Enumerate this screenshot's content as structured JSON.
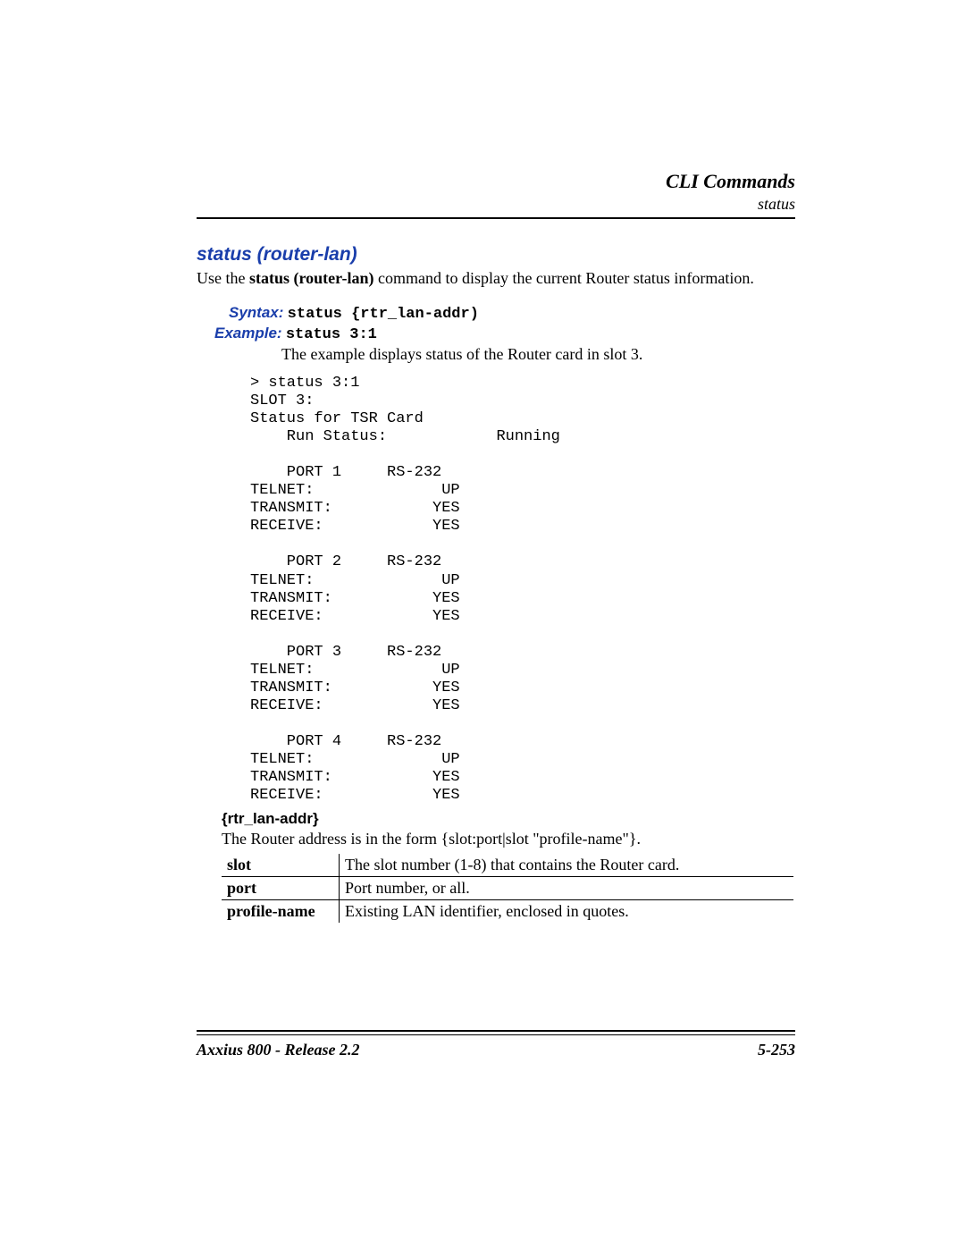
{
  "header": {
    "chapter": "CLI Commands",
    "section": "status"
  },
  "title": "status (router-lan)",
  "intro": {
    "prefix": "Use the ",
    "bold": "status (router-lan)",
    "suffix": " command to display the current Router status information."
  },
  "syntax": {
    "label": "Syntax:",
    "text": "status {rtr_lan-addr)"
  },
  "example": {
    "label": "Example:",
    "text": "status 3:1",
    "explain": "The example displays status of the Router card in slot 3."
  },
  "output": "> status 3:1\nSLOT 3:\nStatus for TSR Card\n    Run Status:            Running\n\n    PORT 1     RS-232\nTELNET:              UP\nTRANSMIT:           YES\nRECEIVE:            YES\n\n    PORT 2     RS-232\nTELNET:              UP\nTRANSMIT:           YES\nRECEIVE:            YES\n\n    PORT 3     RS-232\nTELNET:              UP\nTRANSMIT:           YES\nRECEIVE:            YES\n\n    PORT 4     RS-232\nTELNET:              UP\nTRANSMIT:           YES\nRECEIVE:            YES",
  "param": {
    "heading": "{rtr_lan-addr}",
    "desc": "The Router address is in the form {slot:port|slot \"profile-name\"}.",
    "rows": [
      {
        "name": "slot",
        "desc": "The slot number (1-8) that contains the Router card."
      },
      {
        "name": "port",
        "desc": "Port number, or all."
      },
      {
        "name": "profile-name",
        "desc": "Existing LAN identifier, enclosed in quotes."
      }
    ]
  },
  "footer": {
    "left": "Axxius 800 - Release 2.2",
    "right": "5-253"
  }
}
